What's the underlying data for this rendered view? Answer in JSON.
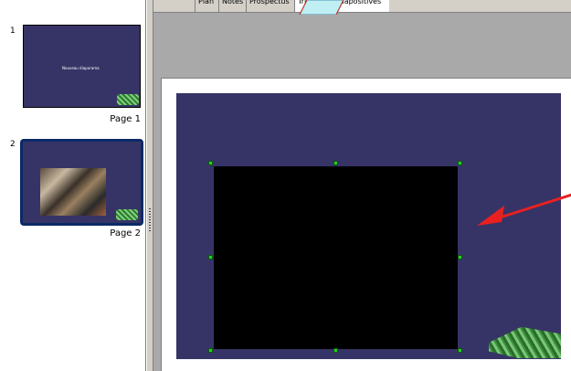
{
  "sorter": {
    "slides": [
      {
        "number": "1",
        "title": "Nouveau diaporama",
        "page_label": "Page 1"
      },
      {
        "number": "2",
        "page_label": "Page 2"
      }
    ]
  },
  "tabs": [
    "Plan",
    "Notes",
    "Prospectus",
    "Trieuse de diapositives"
  ],
  "colors": {
    "slide_bg": "#363466",
    "handle": "#25d025",
    "arrow": "#e82020",
    "selection": "#0a2a66",
    "workspace": "#a9a9a9"
  },
  "icons": [
    "photo-thumbnail",
    "logo-graphic",
    "red-arrow-annotation"
  ]
}
